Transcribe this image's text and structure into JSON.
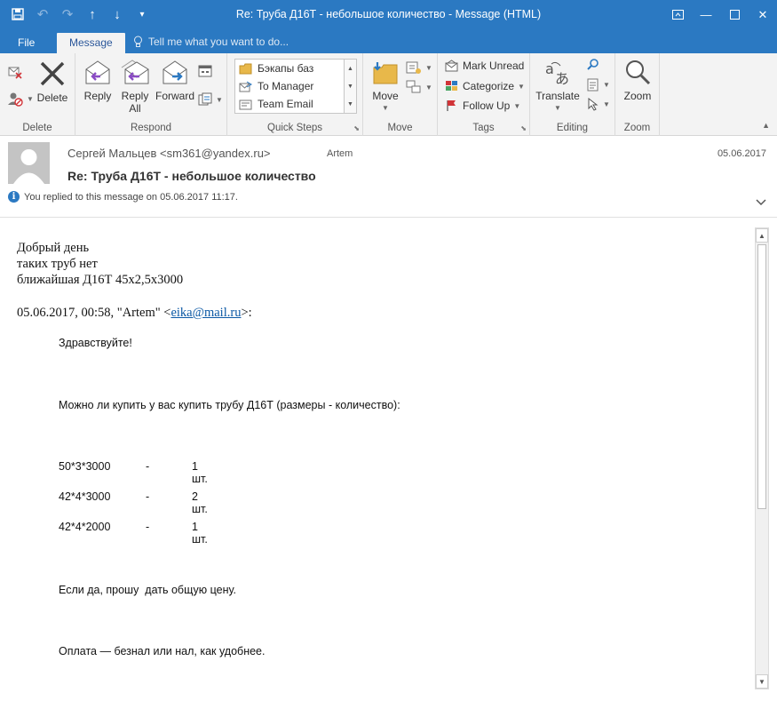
{
  "window": {
    "title": "Re: Труба Д16Т - небольшое количество - Message (HTML)"
  },
  "tabs": {
    "file": "File",
    "message": "Message",
    "tell_me": "Tell me what you want to do..."
  },
  "ribbon": {
    "delete_group": {
      "label": "Delete",
      "delete_button": "Delete"
    },
    "respond_group": {
      "label": "Respond",
      "reply": "Reply",
      "reply_all_1": "Reply",
      "reply_all_2": "All",
      "forward": "Forward"
    },
    "quick_steps": {
      "label": "Quick Steps",
      "items": [
        "Бэкапы баз",
        "To Manager",
        "Team Email"
      ]
    },
    "move_group": {
      "label": "Move",
      "move_button": "Move"
    },
    "tags_group": {
      "label": "Tags",
      "mark_unread": "Mark Unread",
      "categorize": "Categorize",
      "follow_up": "Follow Up"
    },
    "editing_group": {
      "label": "Editing",
      "translate": "Translate"
    },
    "zoom_group": {
      "label": "Zoom",
      "zoom_button": "Zoom"
    }
  },
  "header": {
    "from": "Сергей Мальцев <sm361@yandex.ru>",
    "to": "Artem",
    "date": "05.06.2017",
    "subject": "Re: Труба Д16Т - небольшое количество",
    "replied_info": "You replied to this message on 05.06.2017 11:17."
  },
  "body": {
    "reply_lines": [
      "Добрый день",
      "таких труб нет",
      "ближайшая Д16Т 45х2,5х3000"
    ],
    "quote_header_pre": "05.06.2017, 00:58, \"Artem\" <",
    "quote_header_link": "eika@mail.ru",
    "quote_header_post": ">:",
    "greeting": "Здравствуйте!",
    "question": "Можно ли купить у вас купить трубу Д16Т (размеры - количество):",
    "items": [
      {
        "size": "50*3*3000",
        "dash": "-",
        "qty": "1 шт."
      },
      {
        "size": "42*4*3000",
        "dash": "-",
        "qty": "2 шт."
      },
      {
        "size": "42*4*2000",
        "dash": "-",
        "qty": "1 шт."
      }
    ],
    "price_request": "Если да, прошу  дать общую цену.",
    "payment": "Оплата — безнал или нал, как удобнее."
  },
  "colors": {
    "accent": "#2b79c2",
    "ribbon_bg": "#f3f3f3",
    "link": "#0b58a5"
  }
}
